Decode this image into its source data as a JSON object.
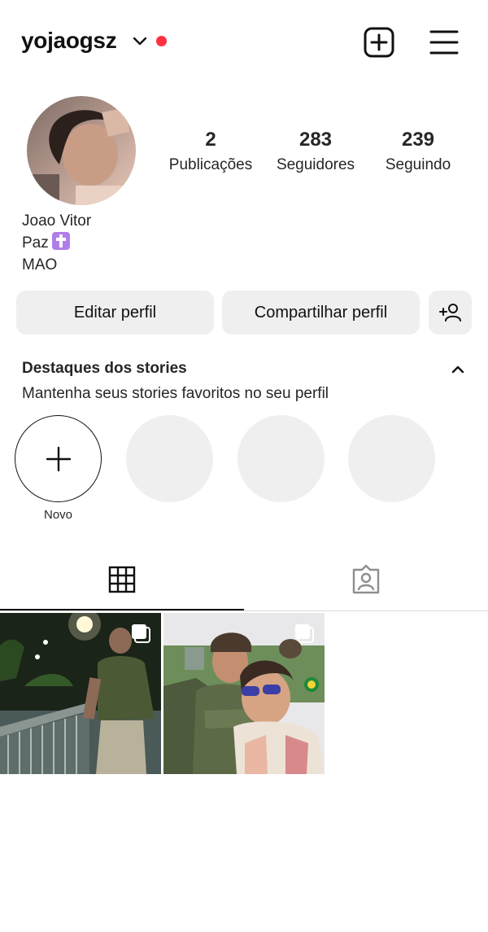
{
  "header": {
    "username": "yojaogsz",
    "icons": [
      "chevron-down-icon",
      "notification-dot",
      "new-post-icon",
      "menu-icon"
    ],
    "accent_dot_color": "#ff3040"
  },
  "profile": {
    "stats": {
      "posts": {
        "count": "2",
        "label": "Publicações"
      },
      "followers": {
        "count": "283",
        "label": "Seguidores"
      },
      "following": {
        "count": "239",
        "label": "Seguindo"
      }
    },
    "name": "Joao Vitor",
    "bio_line1": "Paz",
    "bio_line2": "MAO"
  },
  "actions": {
    "edit_label": "Editar perfil",
    "share_label": "Compartilhar perfil",
    "add_icon": "add-person-icon"
  },
  "highlights": {
    "title": "Destaques dos stories",
    "subtitle": "Mantenha seus stories favoritos no seu perfil",
    "new_label": "Novo"
  },
  "tabs": [
    {
      "icon": "grid-icon",
      "active": true
    },
    {
      "icon": "tagged-icon",
      "active": false
    }
  ],
  "posts": [
    {
      "type": "carousel"
    },
    {
      "type": "carousel"
    }
  ]
}
